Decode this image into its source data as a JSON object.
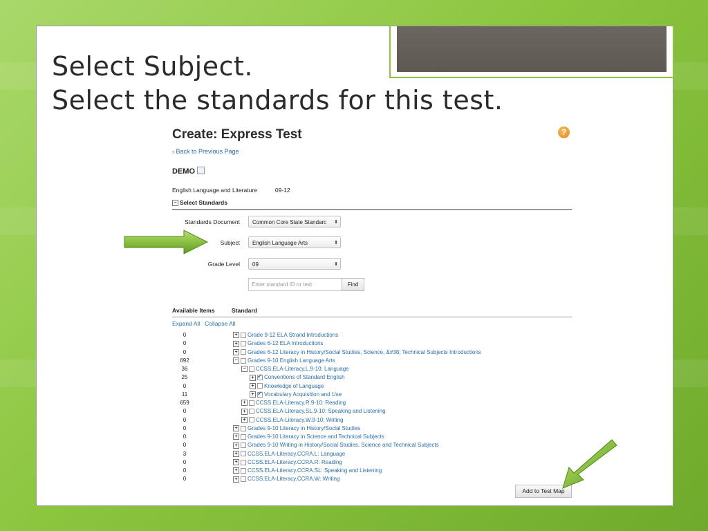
{
  "slide": {
    "title_line1": "Select Subject.",
    "title_line2": "Select the standards for this test."
  },
  "app": {
    "heading": "Create: Express Test",
    "help_label": "?",
    "back_link": "Back to Previous Page",
    "test_name": "DEMO",
    "subject_info": "English Language and Literature",
    "grade_info": "09-12",
    "section_title": "Select Standards",
    "form": {
      "standards_document_label": "Standards Document",
      "standards_document_value": "Common Core State Standarc",
      "subject_label": "Subject",
      "subject_value": "English Language Arts",
      "grade_level_label": "Grade Level",
      "grade_level_value": "09",
      "search_placeholder": "Enter standard ID or text",
      "find_label": "Find"
    },
    "table": {
      "col_available": "Available Items",
      "col_standard": "Standard",
      "expand_all": "Expand All",
      "collapse_all": "Collapse All",
      "rows": [
        {
          "count": "0",
          "label": "Grade 9-12 ELA Strand Introductions",
          "level": 0,
          "expander": "plus",
          "checked": false
        },
        {
          "count": "0",
          "label": "Grades 6-12 ELA Introductions",
          "level": 0,
          "expander": "plus",
          "checked": false
        },
        {
          "count": "0",
          "label": "Grades 6-12 Literacy in History/Social Studies, Science, &#38; Technical Subjects Introductions",
          "level": 0,
          "expander": "plus",
          "checked": false
        },
        {
          "count": "692",
          "label": "Grades 9-10 English Language Arts",
          "level": 0,
          "expander": "minus",
          "checked": false
        },
        {
          "count": "36",
          "label": "CCSS.ELA-Literacy.L.9-10: Language",
          "level": 1,
          "expander": "minus",
          "checked": false
        },
        {
          "count": "25",
          "label": "Conventions of Standard English",
          "level": 2,
          "expander": "plus",
          "checked": true
        },
        {
          "count": "0",
          "label": "Knowledge of Language",
          "level": 2,
          "expander": "plus",
          "checked": false
        },
        {
          "count": "11",
          "label": "Vocabulary Acquisition and Use",
          "level": 2,
          "expander": "plus",
          "checked": true
        },
        {
          "count": "659",
          "label": "CCSS.ELA-Literacy.R.9-10: Reading",
          "level": 1,
          "expander": "plus",
          "checked": false
        },
        {
          "count": "0",
          "label": "CCSS.ELA-Literacy.SL.9-10: Speaking and Listening",
          "level": 1,
          "expander": "plus",
          "checked": false
        },
        {
          "count": "0",
          "label": "CCSS.ELA-Literacy.W.9-10: Writing",
          "level": 1,
          "expander": "plus",
          "checked": false
        },
        {
          "count": "0",
          "label": "Grades 9-10 Literacy in History/Social Studies",
          "level": 0,
          "expander": "plus",
          "checked": false
        },
        {
          "count": "0",
          "label": "Grades 9-10 Literacy in Science and Technical Subjects",
          "level": 0,
          "expander": "plus",
          "checked": false
        },
        {
          "count": "0",
          "label": "Grades 9-10 Writing in History/Social Studies, Science and Technical Subjects",
          "level": 0,
          "expander": "plus",
          "checked": false
        },
        {
          "count": "3",
          "label": "CCSS.ELA-Literacy.CCRA.L: Language",
          "level": 0,
          "expander": "plus",
          "checked": false
        },
        {
          "count": "0",
          "label": "CCSS.ELA-Literacy.CCRA.R: Reading",
          "level": 0,
          "expander": "plus",
          "checked": false
        },
        {
          "count": "0",
          "label": "CCSS.ELA-Literacy.CCRA.SL: Speaking and Listening",
          "level": 0,
          "expander": "plus",
          "checked": false
        },
        {
          "count": "0",
          "label": "CCSS.ELA-Literacy.CCRA.W: Writing",
          "level": 0,
          "expander": "plus",
          "checked": false
        }
      ]
    },
    "add_button": "Add to Test Map"
  },
  "colors": {
    "accent_green": "#8cc63f",
    "link_blue": "#2a6fb2",
    "help_orange": "#e8891b"
  }
}
